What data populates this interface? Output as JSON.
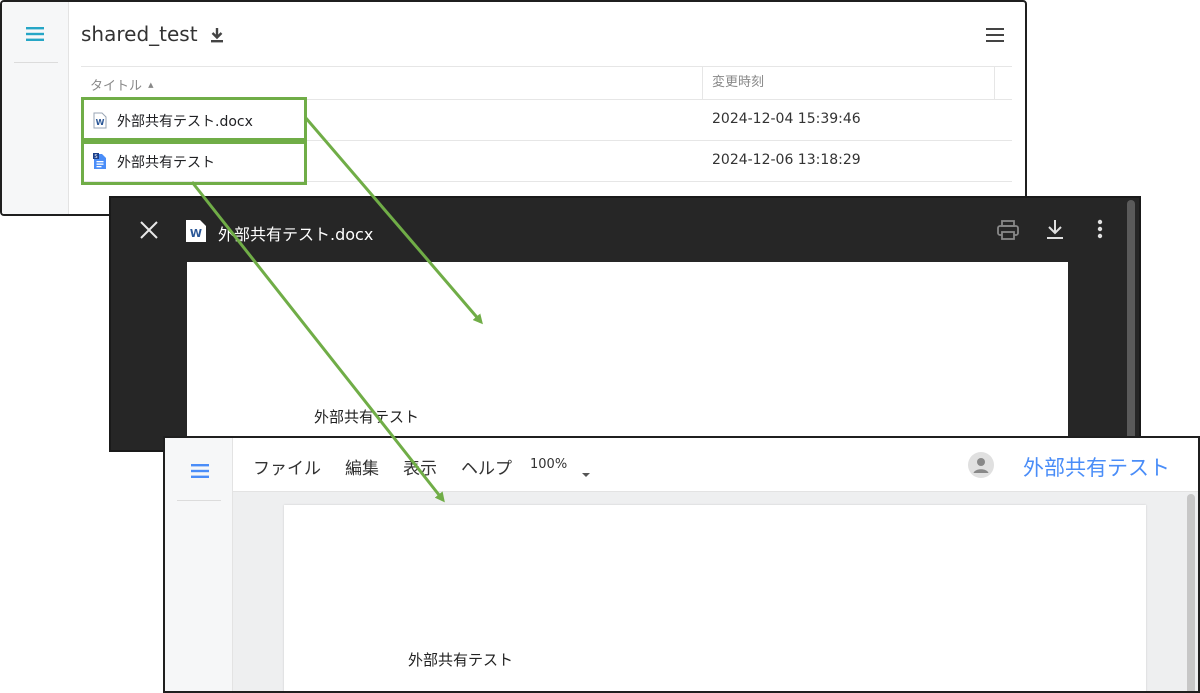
{
  "file_list": {
    "title": "shared_test",
    "columns": {
      "title": "タイトル",
      "modified": "変更時刻"
    },
    "sort_indicator": "▲",
    "rows": [
      {
        "name": "外部共有テスト.docx",
        "modified": "2024-12-04 15:39:46",
        "icon": "word-doc-icon"
      },
      {
        "name": "外部共有テスト",
        "modified": "2024-12-06 13:18:29",
        "icon": "google-docs-icon"
      }
    ]
  },
  "viewer": {
    "title": "外部共有テスト.docx",
    "document_text": "外部共有テスト",
    "icons": [
      "close-icon",
      "word-icon",
      "print-icon",
      "download-icon",
      "more-vert-icon"
    ]
  },
  "docs": {
    "menu": [
      "ファイル",
      "編集",
      "表示",
      "ヘルプ"
    ],
    "zoom": "100%",
    "doc_title": "外部共有テスト",
    "document_text": "外部共有テスト"
  },
  "colors": {
    "highlight": "#70ad47",
    "accent_teal": "#26a6c6",
    "docs_blue": "#4a8df8",
    "viewer_dark": "#262626"
  }
}
